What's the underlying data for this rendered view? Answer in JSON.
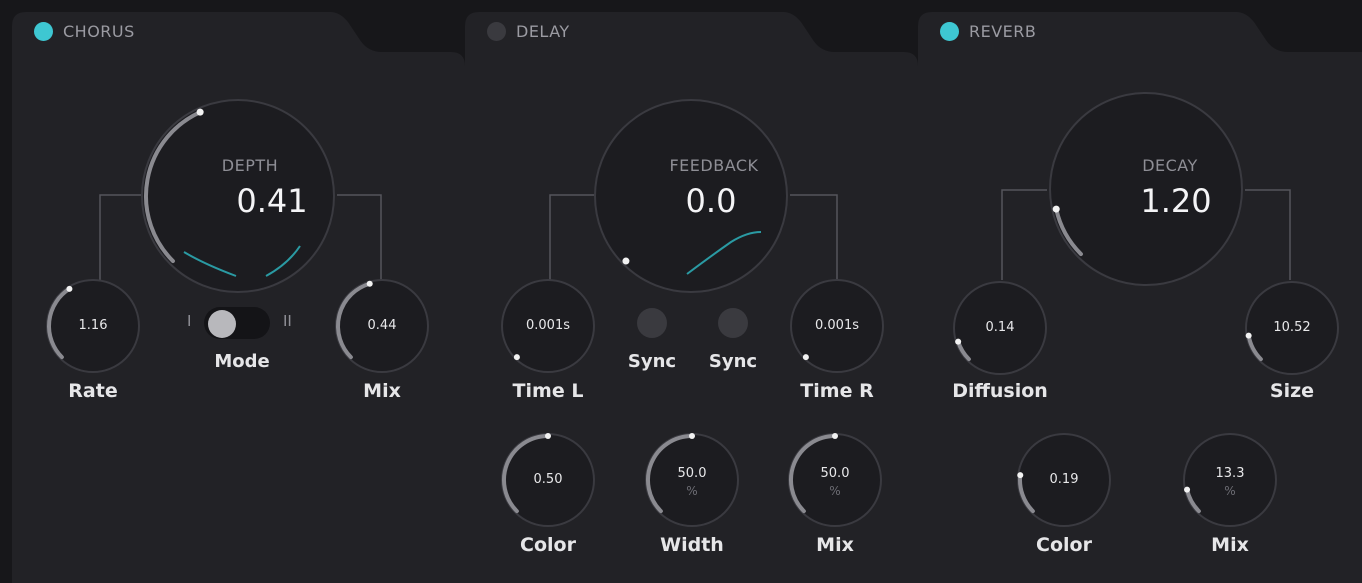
{
  "colors": {
    "accent": "#3ec7d2",
    "panel": "#222226",
    "knob_face": "#1c1c20",
    "knob_ring": "#3a3a40",
    "arc": "#8a8a90",
    "dot": "#f2f2f2"
  },
  "chorus": {
    "title": "CHORUS",
    "power_on": true,
    "depth": {
      "label": "DEPTH",
      "value": "0.41",
      "fraction": 0.41
    },
    "rate": {
      "label": "Rate",
      "value": "1.16",
      "fraction": 0.38
    },
    "mix": {
      "label": "Mix",
      "value": "0.44",
      "fraction": 0.44
    },
    "mode": {
      "label": "Mode",
      "option_1": "I",
      "option_2": "II"
    }
  },
  "delay": {
    "title": "DELAY",
    "power_on": false,
    "feedback": {
      "label": "FEEDBACK",
      "value": "0.0",
      "fraction": 0.0
    },
    "time_l": {
      "label": "Time L",
      "value": "0.001s",
      "fraction": 0.0
    },
    "time_r": {
      "label": "Time R",
      "value": "0.001s",
      "fraction": 0.0
    },
    "sync_l": {
      "label": "Sync"
    },
    "sync_r": {
      "label": "Sync"
    },
    "color": {
      "label": "Color",
      "value": "0.50",
      "fraction": 0.5
    },
    "width": {
      "label": "Width",
      "value": "50.0",
      "unit": "%",
      "fraction": 0.5
    },
    "mix": {
      "label": "Mix",
      "value": "50.0",
      "unit": "%",
      "fraction": 0.5
    }
  },
  "reverb": {
    "title": "REVERB",
    "power_on": true,
    "decay": {
      "label": "DECAY",
      "value": "1.20",
      "fraction": 0.12
    },
    "diffusion": {
      "label": "Diffusion",
      "value": "0.14",
      "fraction": 0.1
    },
    "size": {
      "label": "Size",
      "value": "10.52",
      "fraction": 0.13
    },
    "color": {
      "label": "Color",
      "value": "0.19",
      "fraction": 0.19
    },
    "mix": {
      "label": "Mix",
      "value": "13.3",
      "unit": "%",
      "fraction": 0.12
    }
  }
}
